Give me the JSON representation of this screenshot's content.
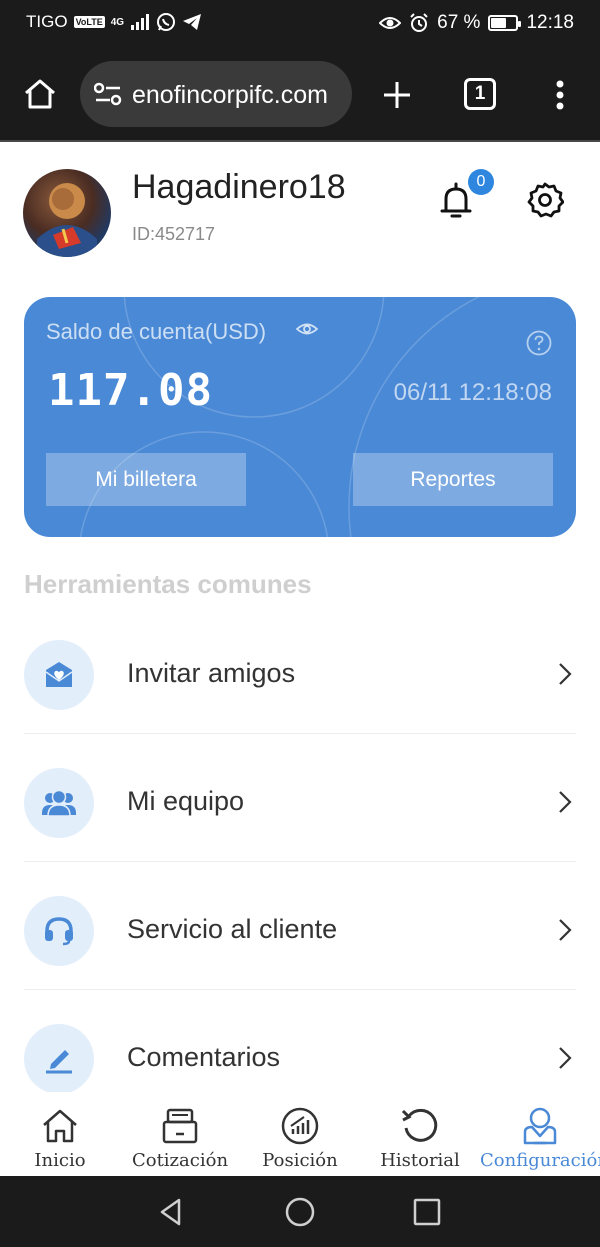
{
  "status_bar": {
    "carrier": "TIGO",
    "volte": "VoLTE",
    "network": "4G",
    "battery": "67 %",
    "battery_level": 0.67,
    "time": "12:18"
  },
  "browser": {
    "url": "enofincorpifc.com",
    "tab_count": "1"
  },
  "profile": {
    "username": "Hagadinero18",
    "user_id": "ID:452717",
    "notification_count": "0"
  },
  "balance_card": {
    "label": "Saldo de cuenta(USD)",
    "amount": "117.08",
    "datetime": "06/11 12:18:08",
    "wallet_button": "Mi billetera",
    "reports_button": "Reportes"
  },
  "tools": {
    "title": "Herramientas comunes",
    "items": [
      {
        "label": "Invitar amigos",
        "icon": "invite-icon"
      },
      {
        "label": "Mi equipo",
        "icon": "team-icon"
      },
      {
        "label": "Servicio al cliente",
        "icon": "headset-icon"
      },
      {
        "label": "Comentarios",
        "icon": "edit-icon"
      }
    ]
  },
  "bottom_nav": {
    "items": [
      {
        "label": "Inicio",
        "icon": "home-icon"
      },
      {
        "label": "Cotización",
        "icon": "quotes-icon"
      },
      {
        "label": "Posición",
        "icon": "position-icon"
      },
      {
        "label": "Historial",
        "icon": "history-icon"
      },
      {
        "label": "Configuración",
        "icon": "settings-user-icon",
        "active": true
      }
    ]
  },
  "colors": {
    "accent": "#4a89d6",
    "badge": "#2e86de",
    "icon_circle": "#e3eefb"
  }
}
